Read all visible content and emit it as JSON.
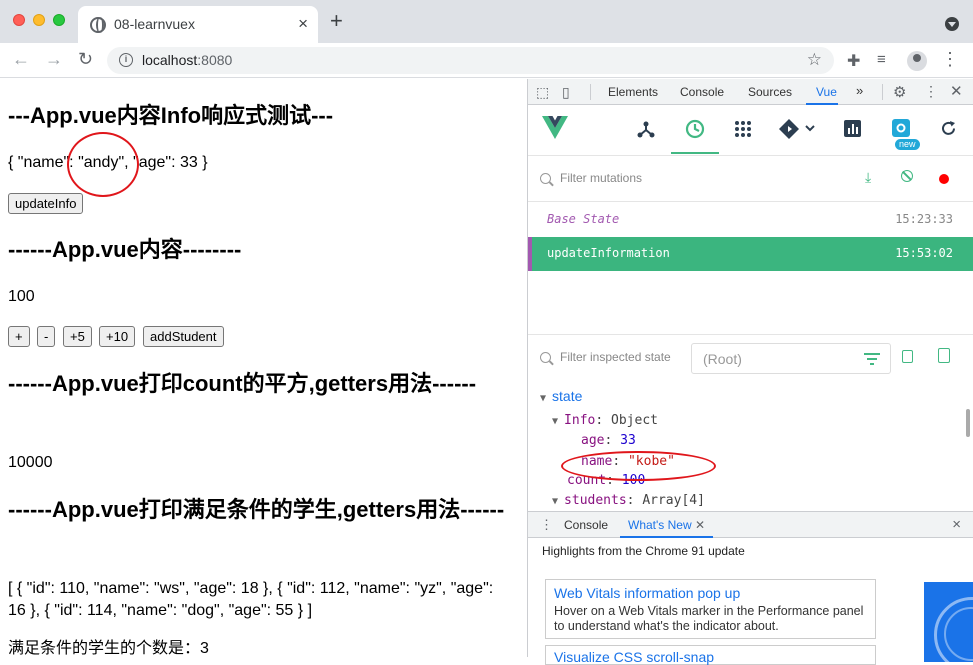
{
  "browser": {
    "tab_title": "08-learnvuex",
    "tab_close": "×",
    "new_tab": "+",
    "url_host": "localhost",
    "url_port": ":8080"
  },
  "page": {
    "heading1": "---App.vue内容Info响应式测试---",
    "info_json": "{ \"name\": \"andy\", \"age\": 33 }",
    "update_info_button": "updateInfo",
    "heading2": "------App.vue内容--------",
    "counter": "100",
    "buttons": [
      "+",
      "-",
      "+5",
      "+10",
      "addStudent"
    ],
    "heading3": "------App.vue打印count的平方,getters用法------",
    "square": "10000",
    "heading4": "------App.vue打印满足条件的学生,getters用法------",
    "students_json": "[ { \"id\": 110, \"name\": \"ws\", \"age\": 18 }, { \"id\": 112, \"name\": \"yz\", \"age\": 16 }, { \"id\": 114, \"name\": \"dog\", \"age\": 55 } ]",
    "student_count": "满足条件的学生的个数是：3"
  },
  "devtools": {
    "tabs": [
      "Elements",
      "Console",
      "Sources",
      "Vue"
    ],
    "more": "»",
    "active_tab": "Vue",
    "vue": {
      "new_badge": "new",
      "filter_mutations_placeholder": "Filter mutations",
      "mutations": [
        {
          "label": "Base State",
          "time": "15:23:33"
        },
        {
          "label": "updateInformation",
          "time": "15:53:02"
        }
      ],
      "filter_state_placeholder": "Filter inspected state",
      "root_select": "(Root)",
      "state": {
        "section": "state",
        "info_key": "Info",
        "info_type": "Object",
        "age_key": "age",
        "age_val": "33",
        "name_key": "name",
        "name_val": "\"kobe\"",
        "count_key": "count",
        "count_val": "100",
        "students_key": "students",
        "students_type": "Array[4]"
      }
    },
    "drawer": {
      "tabs": [
        "Console",
        "What's New"
      ],
      "close": "×",
      "whats_new_title": "Highlights from the Chrome 91 update",
      "card1_title": "Web Vitals information pop up",
      "card1_desc": "Hover on a Web Vitals marker in the Performance panel to understand what's the indicator about.",
      "card2_title": "Visualize CSS scroll-snap"
    }
  },
  "colors": {
    "vue_green": "#42b883",
    "selected_row": "#3bb57f",
    "annotation_red": "#e0161b",
    "devtools_blue": "#1a73e8"
  }
}
